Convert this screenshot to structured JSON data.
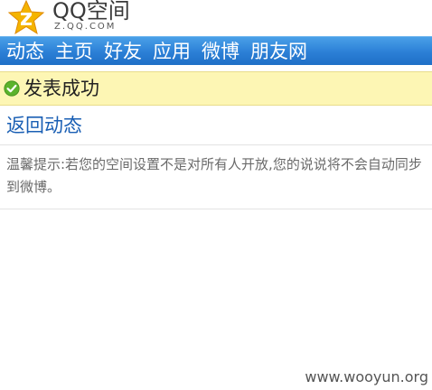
{
  "logo": {
    "brand": "QQ空间",
    "subtitle": "Z.QQ.COM",
    "icon": "qq-star-icon",
    "colors": {
      "star": "#f4b400",
      "star_dark": "#e08a00"
    }
  },
  "nav": {
    "items": [
      {
        "label": "动态"
      },
      {
        "label": "主页"
      },
      {
        "label": "好友"
      },
      {
        "label": "应用"
      },
      {
        "label": "微博"
      },
      {
        "label": "朋友网"
      }
    ],
    "color": "#2b7fd6"
  },
  "status": {
    "icon": "check-circle-icon",
    "message": "发表成功",
    "background": "#fdf6b4",
    "icon_color": "#5bb32c"
  },
  "back_link": {
    "label": "返回动态",
    "color": "#1a5fb4"
  },
  "tip": {
    "text": "温馨提示:若您的空间设置不是对所有人开放,您的说说将不会自动同步到微博。"
  },
  "watermark": {
    "text": "www.wooyun.org"
  }
}
